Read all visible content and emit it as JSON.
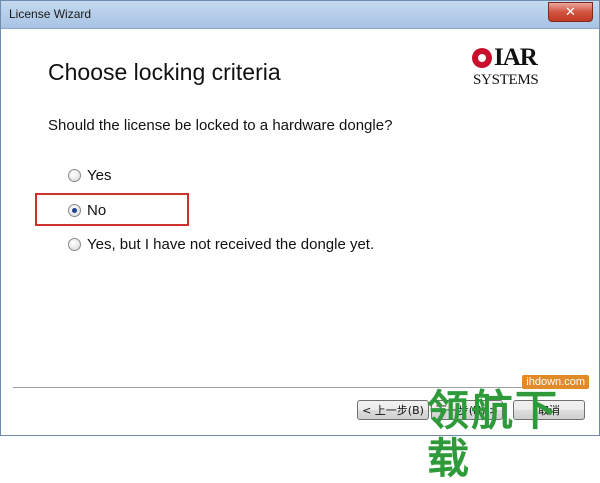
{
  "window": {
    "title": "License Wizard",
    "close_label": "✕"
  },
  "header": {
    "title": "Choose locking criteria",
    "logo": {
      "word": "IAR",
      "sub": "SYSTEMS"
    }
  },
  "main": {
    "question": "Should the license be locked to a hardware dongle?",
    "options": [
      {
        "label": "Yes",
        "checked": false
      },
      {
        "label": "No",
        "checked": true
      },
      {
        "label": "Yes, but I have not received the dongle yet.",
        "checked": false
      }
    ]
  },
  "footer": {
    "back_label": "< 上一步(B)",
    "next_label": "下一步(N) >",
    "cancel_label": "取消"
  },
  "watermark": {
    "url": "ihdown.com",
    "text": "领航下载"
  },
  "colors": {
    "highlight": "#d0312d",
    "logo_red": "#c8102e",
    "watermark_green": "#2f9a3a"
  }
}
